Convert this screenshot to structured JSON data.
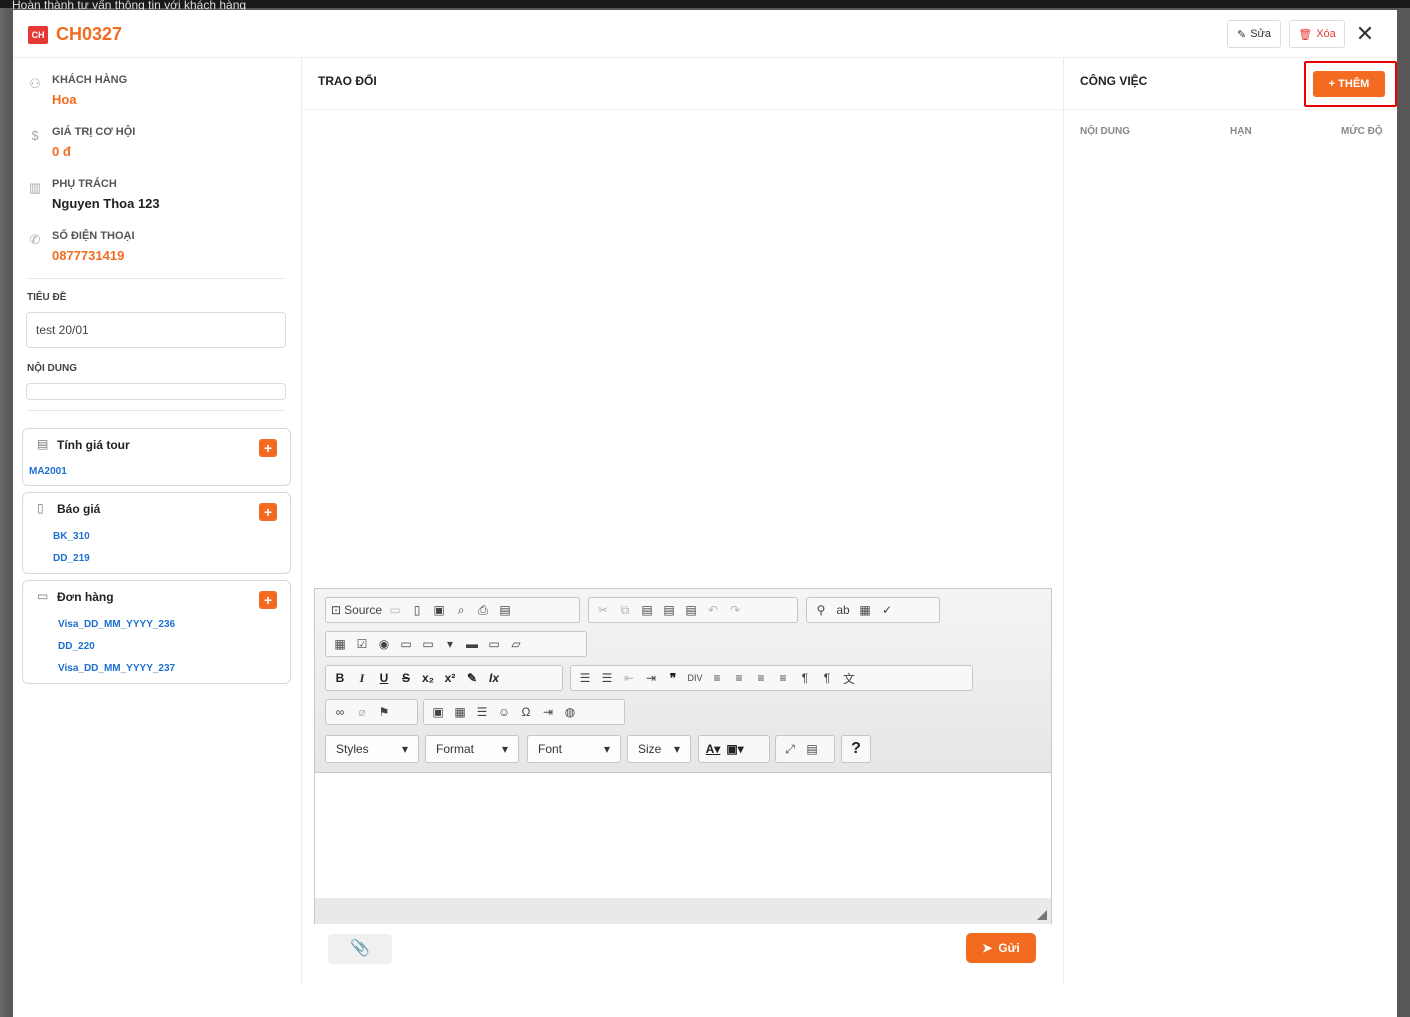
{
  "background": {
    "text": "Hoàn thành tư vấn thông tin với khách hàng"
  },
  "header": {
    "badge": "CH",
    "code": "CH0327",
    "edit_label": "Sửa",
    "delete_label": "Xóa",
    "close": "✕"
  },
  "info": {
    "customer_label": "KHÁCH HÀNG",
    "customer_value": "Hoa",
    "value_label": "GIÁ TRỊ CƠ HỘI",
    "value_value": "0 đ",
    "owner_label": "PHỤ TRÁCH",
    "owner_value": "Nguyen Thoa 123",
    "phone_label": "SỐ ĐIỆN THOẠI",
    "phone_value": "0877731419"
  },
  "form": {
    "title_label": "TIÊU ĐỀ",
    "title_value": "test 20/01",
    "content_label": "NỘI DUNG",
    "content_value": ""
  },
  "cards": {
    "tour": {
      "title": "Tính giá tour",
      "items": [
        "MA2001"
      ]
    },
    "quote": {
      "title": "Báo giá",
      "items": [
        "BK_310",
        "DD_219"
      ]
    },
    "order": {
      "title": "Đơn hàng",
      "items": [
        "Visa_DD_MM_YYYY_236",
        "DD_220",
        "Visa_DD_MM_YYYY_237"
      ]
    }
  },
  "middle": {
    "title": "TRAO ĐỔI",
    "send_label": "Gửi"
  },
  "editor": {
    "source_label": "Source",
    "styles": "Styles",
    "format": "Format",
    "font": "Font",
    "size": "Size",
    "help": "?"
  },
  "right": {
    "title": "CÔNG VIỆC",
    "add_label": "+ THÊM",
    "columns": [
      "NỘI DUNG",
      "HẠN",
      "MỨC ĐỘ"
    ]
  },
  "colors": {
    "accent": "#f26b21",
    "danger": "#e53935",
    "link": "#1e6fd0",
    "highlight": "#ee0000"
  }
}
